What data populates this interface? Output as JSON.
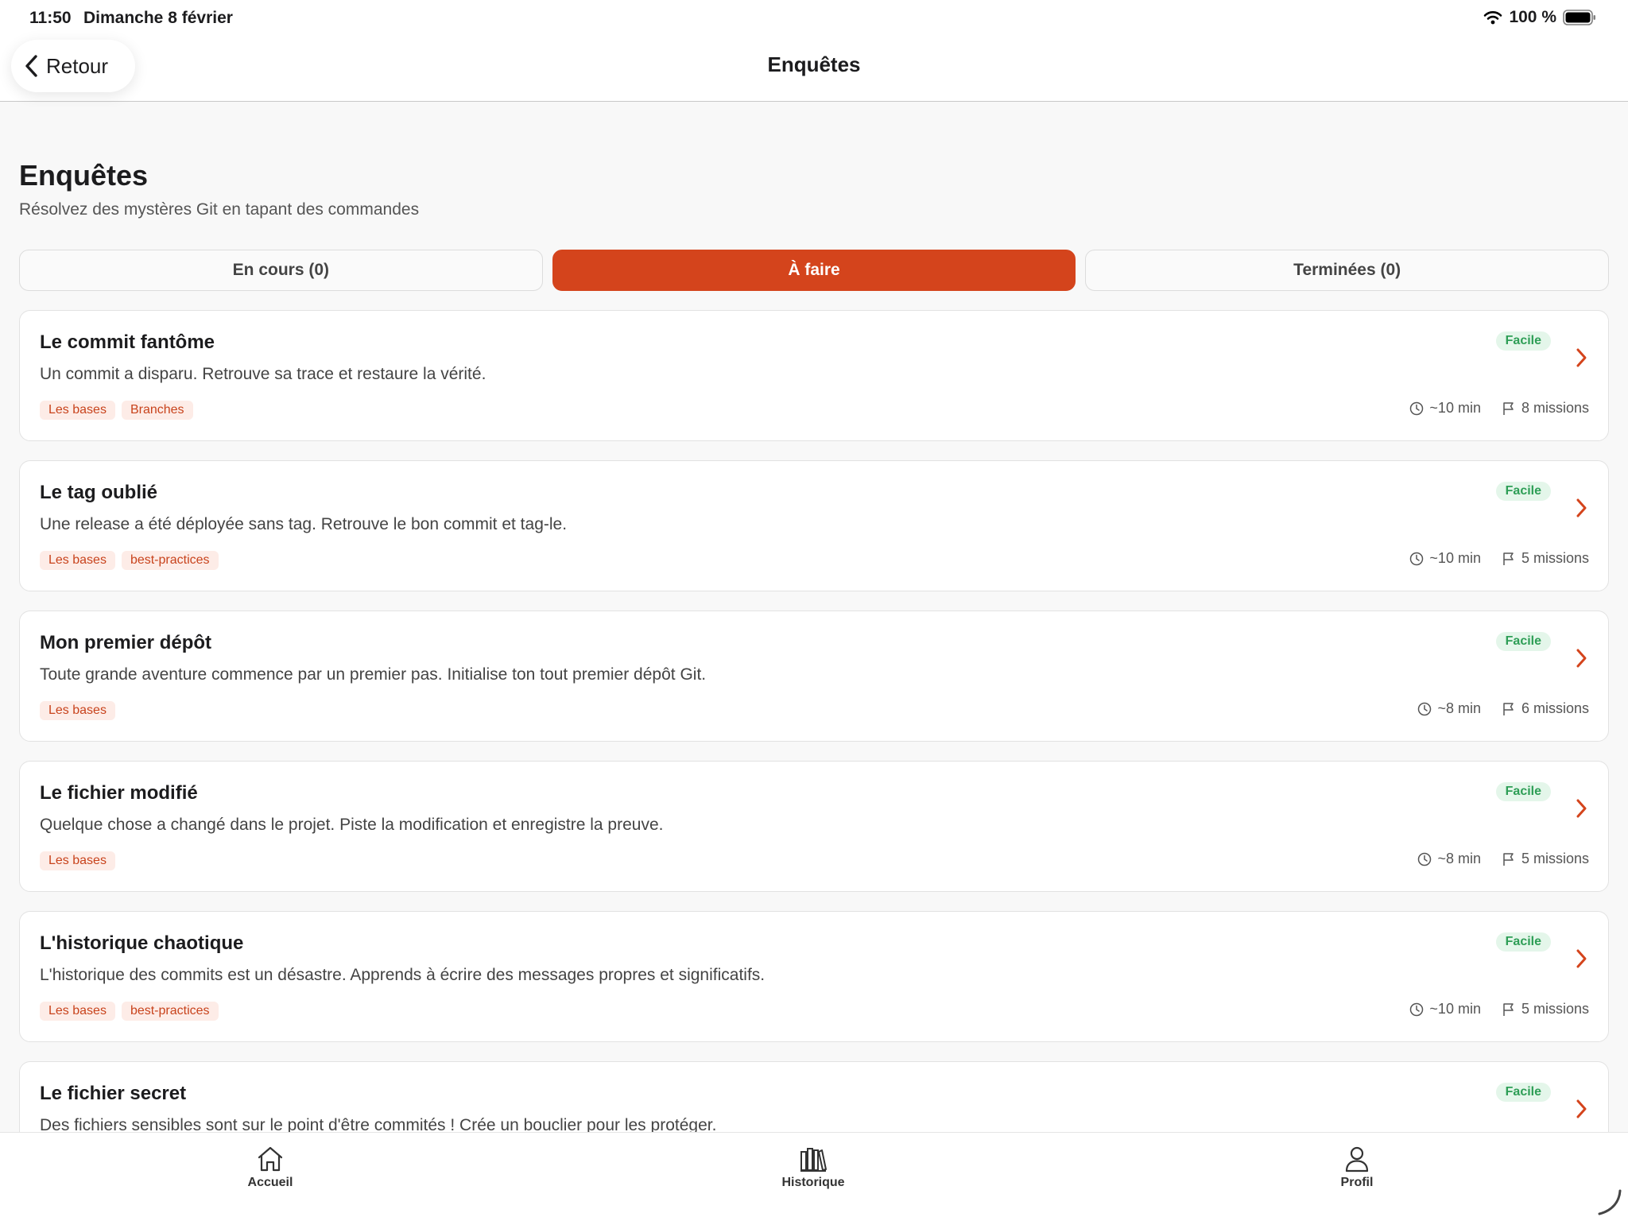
{
  "status_bar": {
    "time": "11:50",
    "date": "Dimanche 8 février",
    "battery": "100 %"
  },
  "nav": {
    "back_label": "Retour",
    "title": "Enquêtes"
  },
  "header": {
    "title": "Enquêtes",
    "subtitle": "Résolvez des mystères Git en tapant des commandes"
  },
  "tabs": [
    {
      "label": "En cours (0)",
      "active": false
    },
    {
      "label": "À faire",
      "active": true
    },
    {
      "label": "Terminées (0)",
      "active": false
    }
  ],
  "investigations": [
    {
      "title": "Le commit fantôme",
      "description": "Un commit a disparu. Retrouve sa trace et restaure la vérité.",
      "tags": [
        "Les bases",
        "Branches"
      ],
      "difficulty": "Facile",
      "duration": "~10 min",
      "missions": "8 missions"
    },
    {
      "title": "Le tag oublié",
      "description": "Une release a été déployée sans tag. Retrouve le bon commit et tag-le.",
      "tags": [
        "Les bases",
        "best-practices"
      ],
      "difficulty": "Facile",
      "duration": "~10 min",
      "missions": "5 missions"
    },
    {
      "title": "Mon premier dépôt",
      "description": "Toute grande aventure commence par un premier pas. Initialise ton tout premier dépôt Git.",
      "tags": [
        "Les bases"
      ],
      "difficulty": "Facile",
      "duration": "~8 min",
      "missions": "6 missions"
    },
    {
      "title": "Le fichier modifié",
      "description": "Quelque chose a changé dans le projet. Piste la modification et enregistre la preuve.",
      "tags": [
        "Les bases"
      ],
      "difficulty": "Facile",
      "duration": "~8 min",
      "missions": "5 missions"
    },
    {
      "title": "L'historique chaotique",
      "description": "L'historique des commits est un désastre. Apprends à écrire des messages propres et significatifs.",
      "tags": [
        "Les bases",
        "best-practices"
      ],
      "difficulty": "Facile",
      "duration": "~10 min",
      "missions": "5 missions"
    },
    {
      "title": "Le fichier secret",
      "description": "Des fichiers sensibles sont sur le point d'être commités ! Crée un bouclier pour les protéger.",
      "tags": [],
      "difficulty": "Facile",
      "duration": "",
      "missions": ""
    }
  ],
  "tab_bar": [
    {
      "label": "Accueil",
      "icon": "home-icon"
    },
    {
      "label": "Historique",
      "icon": "library-icon"
    },
    {
      "label": "Profil",
      "icon": "person-icon"
    }
  ],
  "colors": {
    "accent": "#d4441c",
    "tag_bg": "#fdece7",
    "difficulty_bg": "#e4f6ea",
    "difficulty_text": "#2e9e56"
  }
}
